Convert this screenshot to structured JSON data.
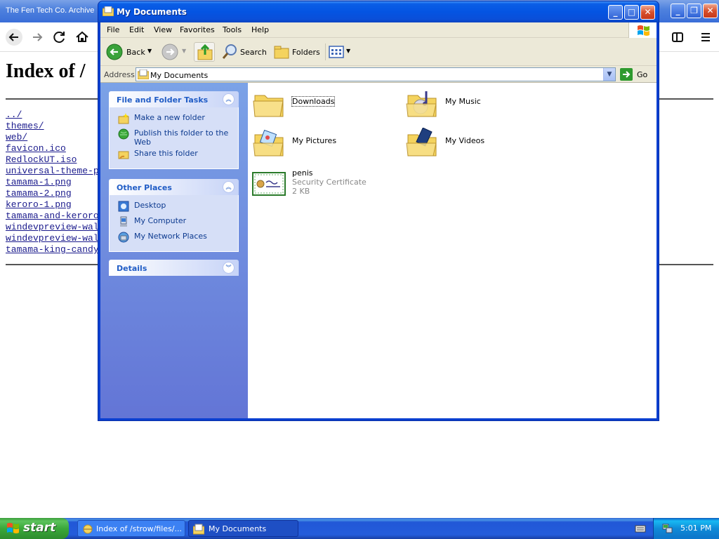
{
  "browser": {
    "title": "The Fen Tech Co. Archive",
    "heading": "Index of /",
    "files": [
      "../",
      "themes/",
      "web/",
      "favicon.ico",
      "RedlockUT.iso",
      "universal-theme-p",
      "tamama-1.png",
      "tamama-2.png",
      "keroro-1.png",
      "tamama-and-keroro",
      "windevpreview-wal",
      "windevpreview-wal",
      "tamama-king-candy"
    ]
  },
  "explorer": {
    "title": "My Documents",
    "menu": [
      "File",
      "Edit",
      "View",
      "Favorites",
      "Tools",
      "Help"
    ],
    "toolbar": {
      "back": "Back",
      "search": "Search",
      "folders": "Folders"
    },
    "address": {
      "label": "Address",
      "value": "My Documents",
      "go": "Go"
    },
    "tasks": {
      "header": "File and Folder Tasks",
      "items": [
        "Make a new folder",
        "Publish this folder to the Web",
        "Share this folder"
      ]
    },
    "places": {
      "header": "Other Places",
      "items": [
        "Desktop",
        "My Computer",
        "My Network Places"
      ]
    },
    "details": {
      "header": "Details"
    },
    "files": [
      {
        "name": "Downloads"
      },
      {
        "name": "My Music"
      },
      {
        "name": "My Pictures"
      },
      {
        "name": "My Videos"
      },
      {
        "name": "penis",
        "type": "Security Certificate",
        "size": "2 KB"
      }
    ]
  },
  "taskbar": {
    "start": "start",
    "tasks": [
      "Index of /strow/files/...",
      "My Documents"
    ],
    "clock": "5:01 PM"
  },
  "colors": {
    "xp_blue": "#0a3fd0",
    "taskpane": "#7ba2e7",
    "start_green": "#3aa83a"
  }
}
